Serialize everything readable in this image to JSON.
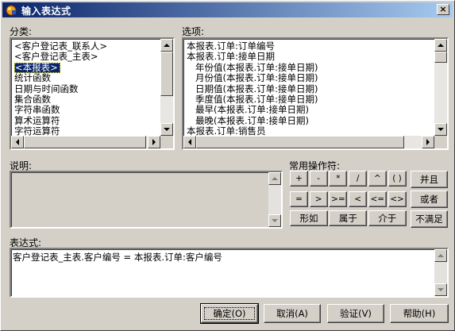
{
  "window": {
    "title": "输入表达式",
    "close_label": "×"
  },
  "category": {
    "label": "分类:",
    "items": [
      "<客户登记表_联系人>",
      "<客户登记表_主表>",
      "<本报表>",
      "统计函数",
      "日期与时间函数",
      "集合函数",
      "字符串函数",
      "算术运算符",
      "字符运算符"
    ],
    "selected_index": 2
  },
  "options": {
    "label": "选项:",
    "items": [
      "本报表.订单:订单编号",
      "本报表.订单:接单日期",
      "   年份值(本报表.订单:接单日期)",
      "   月份值(本报表.订单:接单日期)",
      "   日期值(本报表.订单:接单日期)",
      "   季度值(本报表.订单:接单日期)",
      "   最早(本报表.订单:接单日期)",
      "   最晚(本报表.订单:接单日期)",
      "本报表.订单:销售员"
    ]
  },
  "description": {
    "label": "说明:"
  },
  "operators": {
    "label": "常用操作符:",
    "row1": [
      "+",
      "-",
      "*",
      "/",
      "^",
      "( )"
    ],
    "row2": [
      "=",
      ">",
      ">=",
      "<",
      "<=",
      "<>"
    ],
    "row3": [
      "形如",
      "属于",
      "介于"
    ],
    "logic": [
      "并且",
      "或者",
      "不满足"
    ]
  },
  "expression": {
    "label": "表达式:",
    "value": "客户登记表_主表.客户编号 = 本报表.订单:客户编号"
  },
  "buttons": {
    "ok": "确定(O)",
    "cancel": "取消(A)",
    "verify": "验证(V)",
    "help": "帮助(H)"
  }
}
